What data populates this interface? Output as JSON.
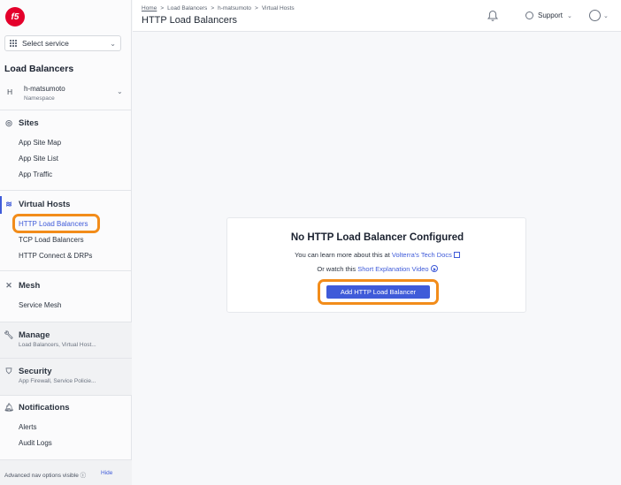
{
  "sidebar": {
    "logo_text": "f5",
    "service_select": {
      "label": "Select service"
    },
    "section_title": "Load Balancers",
    "namespace": {
      "avatar": "H",
      "name": "h-matsumoto",
      "sub": "Namespace"
    },
    "groups": {
      "sites": {
        "title": "Sites",
        "items": [
          "App Site Map",
          "App Site List",
          "App Traffic"
        ]
      },
      "virtual_hosts": {
        "title": "Virtual Hosts",
        "items": [
          "HTTP Load Balancers",
          "TCP Load Balancers",
          "HTTP Connect & DRPs"
        ]
      },
      "mesh": {
        "title": "Mesh",
        "items": [
          "Service Mesh"
        ]
      },
      "manage": {
        "title": "Manage",
        "sub": "Load Balancers, Virtual Host..."
      },
      "security": {
        "title": "Security",
        "sub": "App Firewall, Service Policie..."
      },
      "notifications": {
        "title": "Notifications",
        "items": [
          "Alerts",
          "Audit Logs"
        ]
      }
    },
    "footer": {
      "text": "Advanced nav options visible ⓘ",
      "hide": "Hide"
    }
  },
  "header": {
    "breadcrumbs": [
      "Home",
      ">",
      "Load Balancers",
      ">",
      "h-matsumoto",
      ">",
      "Virtual Hosts"
    ],
    "title": "HTTP Load Balancers",
    "support_label": "Support"
  },
  "empty_state": {
    "title": "No HTTP Load Balancer Configured",
    "line1_prefix": "You can learn more about this at ",
    "line1_link": "Volterra's Tech Docs",
    "line2_prefix": "Or watch this ",
    "line2_link": "Short Explanation Video",
    "button": "Add HTTP Load Balancer"
  },
  "colors": {
    "accent": "#3f5bd9",
    "highlight": "#f28c1a",
    "brand": "#e4002b"
  }
}
